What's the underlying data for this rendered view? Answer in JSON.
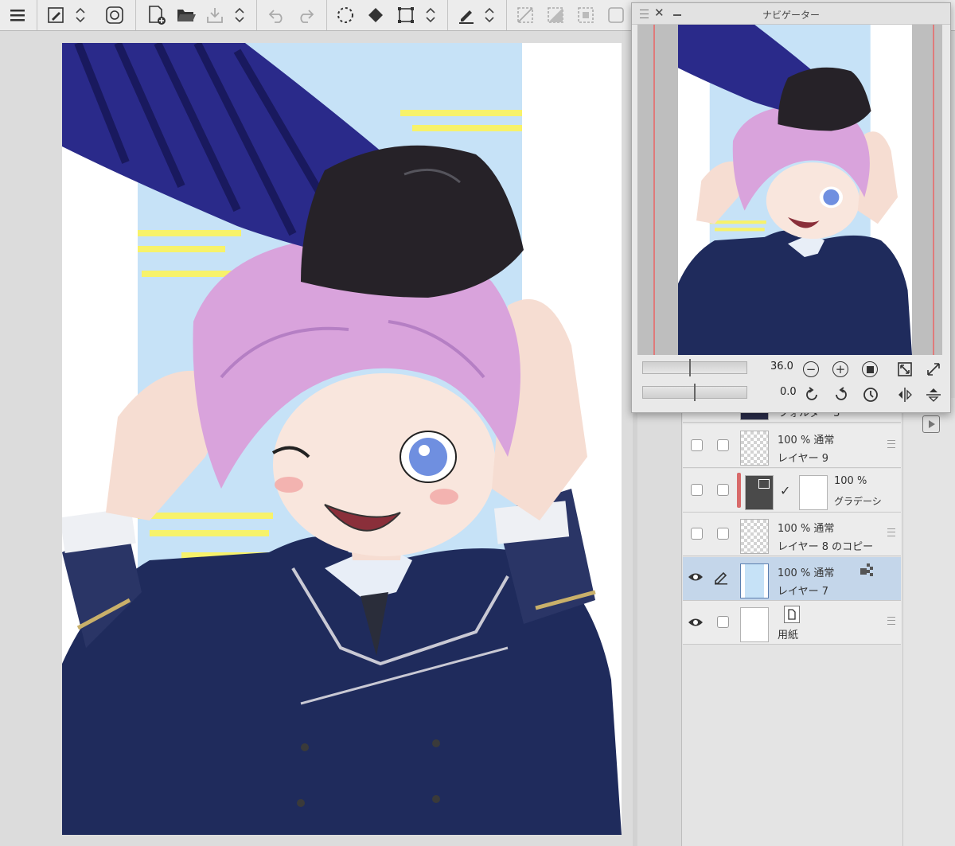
{
  "navigator": {
    "title": "ナビゲーター",
    "zoom": "36.0",
    "rotation": "0.0"
  },
  "layers": [
    {
      "opacity": "",
      "name": "フォルダー 3",
      "visible": false,
      "thumb": "folder"
    },
    {
      "opacity": "100 % 通常",
      "name": "レイヤー 9",
      "visible": false,
      "thumb": "transparent"
    },
    {
      "opacity": "100 %",
      "name": "グラデーシ",
      "visible": false,
      "thumb": "gradient"
    },
    {
      "opacity": "100 % 通常",
      "name": "レイヤー 8 のコピー",
      "visible": false,
      "thumb": "transparent"
    },
    {
      "opacity": "100 % 通常",
      "name": "レイヤー 7",
      "visible": true,
      "thumb": "art",
      "selected": true
    },
    {
      "opacity": "",
      "name": "用紙",
      "visible": true,
      "thumb": "paper"
    }
  ],
  "colors": {
    "accent_selected": "#c4d6ea",
    "sky": "#c6e2f7",
    "hair": "#d9a3dc",
    "uniform": "#1f2b5c",
    "sleeve": "#2a2a8a"
  },
  "icons": [
    "menu-icon",
    "pen-settings-icon",
    "up-down-icon",
    "rotate-icon",
    "new-page-icon",
    "open-folder-icon",
    "save-icon",
    "undo-icon",
    "redo-icon",
    "selection-icon",
    "fill-icon",
    "transform-icon",
    "pen-icon",
    "deselect-icon",
    "invert-select-icon",
    "select-more-icon",
    "select-all-icon"
  ]
}
